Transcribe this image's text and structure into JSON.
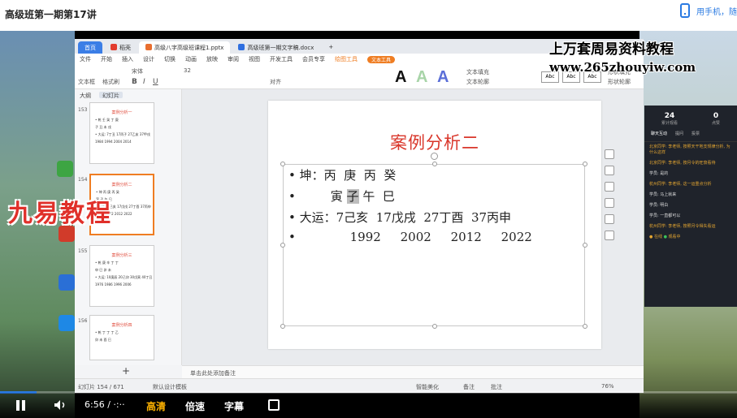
{
  "page": {
    "title": "高级班第一期第17讲",
    "phone_link": "用手机，随"
  },
  "watermarks": {
    "line1": "上万套周易资料教程",
    "line2": "www.265zhouyiw.com",
    "logo_text": "九易教程"
  },
  "wps": {
    "tabs": [
      {
        "label": "首页"
      },
      {
        "label": "稻壳"
      },
      {
        "label": "高级八字高级班课程1.pptx"
      },
      {
        "label": "高级班第一期文字稿.docx"
      }
    ],
    "menu": [
      "文件",
      "开始",
      "插入",
      "设计",
      "切换",
      "动画",
      "放映",
      "审阅",
      "视图",
      "开发工具",
      "会员专享",
      "绘图工具",
      "文本工具"
    ],
    "text_tools_badge": "文本工具",
    "font_name": "宋体",
    "font_size": "32",
    "ribbon_labels": [
      "文本框",
      "格式刷",
      "对齐",
      "文本填充",
      "文本轮廓",
      "形状填充",
      "形状轮廓",
      "形状效果"
    ],
    "side_tabs": [
      "大纲",
      "幻灯片"
    ],
    "thumbnails": [
      {
        "num": "153",
        "title": "案例分析一",
        "lines": [
          "• 乾  壬  癸  丁  庚",
          "      子  丑  未  戌",
          "• 大运: 7丁丑 17丙子 27乙亥 37甲戌",
          "      1984  1994  2004  2014"
        ]
      },
      {
        "num": "154",
        "title": "案例分析二",
        "lines": [
          "• 坤  丙  庚  丙  癸",
          "      寅  子  午  巳",
          "• 大运: 7己亥 17戊戌 27丁酉 37丙申",
          "      1992  2002  2012  2022"
        ]
      },
      {
        "num": "155",
        "title": "案例分析三",
        "lines": [
          "• 乾  庚  辛  丁  丁",
          "      申  巳  卯  未",
          "• 大运: 10庚辰 20己卯 30戊寅 40丁丑",
          "      1976  1986  1996  2006"
        ]
      },
      {
        "num": "156",
        "title": "案例分析四",
        "lines": [
          "• 乾  丁  丁  丁  乙",
          "      卯  未  酉  巳"
        ]
      }
    ],
    "slide": {
      "title": "案例分析二",
      "line1": "• 坤：丙  庚  丙  癸",
      "line2_pre": "•         寅 ",
      "line2_hl": "子",
      "line2_post": " 午  巳",
      "line3": "• 大运：7己亥  17戊戌  27丁酉  37丙申",
      "line4": "•              1992     2002     2012     2022"
    },
    "notes_placeholder": "单击此处添加备注",
    "status": {
      "slide_count": "幻灯片 154 / 671",
      "design": "默认设计模板",
      "smart": "智能美化",
      "notes": "备注",
      "comments": "批注",
      "zoom": "76%"
    }
  },
  "chat": {
    "count_left": "24",
    "count_left_label": "累计观看",
    "count_right": "0",
    "count_right_label": "点赞",
    "tabs": [
      "聊天互动",
      "提问",
      "投票"
    ],
    "messages": [
      {
        "text": "北京同学: 李老师, 按照天干地支规律分析, 为什么这样",
        "style": "gold"
      },
      {
        "text": "北京同学: 李老师, 按月令的旺衰看待",
        "style": "gold"
      },
      {
        "text": "学员: 是的",
        "style": "white"
      },
      {
        "text": "杭州同学: 李老师, 这一运重点分析",
        "style": "gold"
      },
      {
        "text": "学员: 马上就来",
        "style": "white"
      },
      {
        "text": "学员: 明白",
        "style": "white"
      },
      {
        "text": "学员: 一直都可以",
        "style": "white"
      },
      {
        "text": "杭州同学: 李老师, 按照月令得失看运",
        "style": "gold"
      }
    ],
    "online": "在线",
    "viewers": "观看中"
  },
  "player": {
    "time": "6:56 / ·:··",
    "quality": "高清",
    "speed": "倍速",
    "subtitle": "字幕",
    "progress": 0.05
  }
}
